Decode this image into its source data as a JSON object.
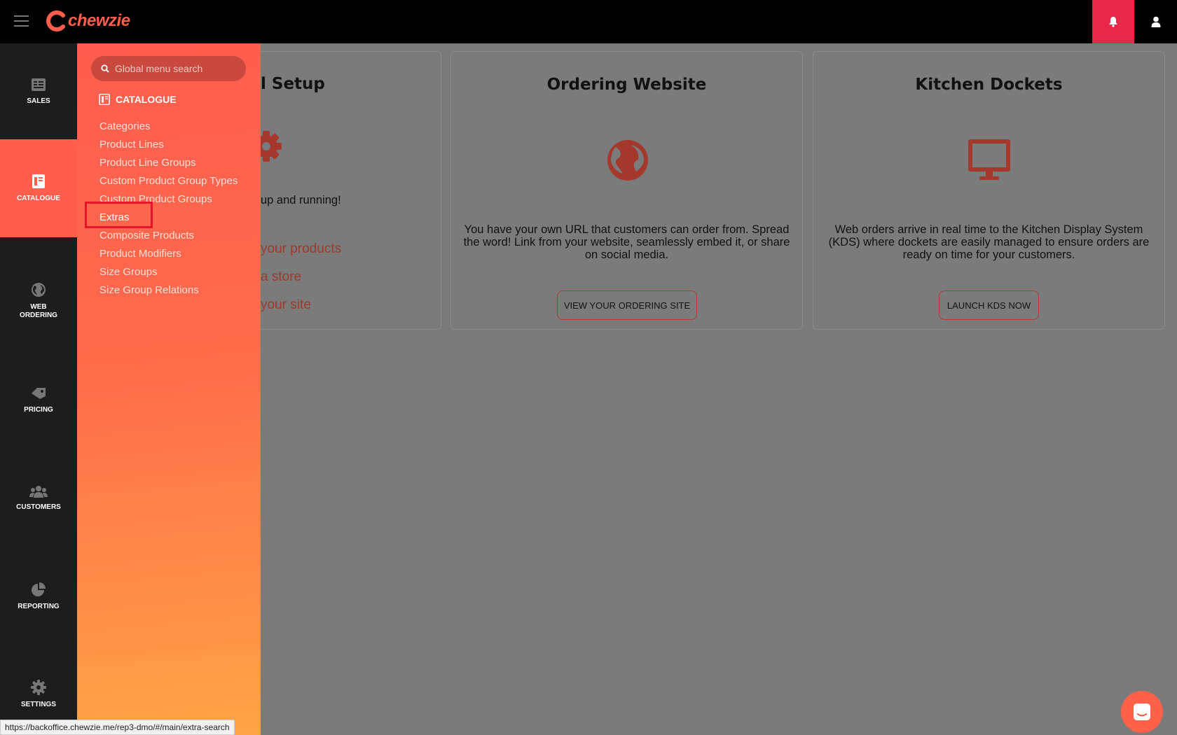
{
  "app": {
    "brand": "chewzie",
    "colors": {
      "accent": "#ff5e4d",
      "bell_bg": "#e8274b",
      "sidebar_bg": "#1d1d1d",
      "topbar_bg": "#000000"
    }
  },
  "topbar": {
    "menu_icon": "hamburger-icon",
    "bell_icon": "bell-icon",
    "user_icon": "user-icon"
  },
  "leftnav": {
    "items": [
      {
        "label": "SALES",
        "icon": "receipt-icon"
      },
      {
        "label": "CATALOGUE",
        "icon": "catalogue-icon",
        "active": true
      },
      {
        "label": "WEB\nORDERING",
        "icon": "globe-icon"
      },
      {
        "label": "PRICING",
        "icon": "price-tag-icon"
      },
      {
        "label": "CUSTOMERS",
        "icon": "users-icon"
      },
      {
        "label": "REPORTING",
        "icon": "pie-chart-icon"
      },
      {
        "label": "SETTINGS",
        "icon": "gear-icon"
      }
    ]
  },
  "flyout": {
    "search": {
      "placeholder": "Global menu search"
    },
    "section_title": "CATALOGUE",
    "items": [
      "Categories",
      "Product Lines",
      "Product Line Groups",
      "Custom Product Group Types",
      "Custom Product Groups",
      "Extras",
      "Composite Products",
      "Product Modifiers",
      "Size Groups",
      "Size Group Relations"
    ],
    "selected": "Extras"
  },
  "main": {
    "partial_card": {
      "title": "l Setup",
      "text": "up and running!",
      "links": [
        "your products",
        "a store",
        "your site"
      ]
    },
    "cards": [
      {
        "title": "Ordering Website",
        "icon": "globe-icon",
        "description": "You have your own URL that customers can order from. Spread the word! Link from your website, seamlessly embed it, or share on social media.",
        "button": "VIEW YOUR ORDERING SITE"
      },
      {
        "title": "Kitchen Dockets",
        "icon": "monitor-icon",
        "description": "Web orders arrive in real time to the Kitchen Display System (KDS) where dockets are easily managed to ensure orders are ready on time for your customers.",
        "button": "LAUNCH KDS NOW"
      }
    ]
  },
  "status_bar": {
    "url": "https://backoffice.chewzie.me/rep3-dmo/#/main/extra-search"
  },
  "chat": {
    "icon": "chat-icon"
  }
}
